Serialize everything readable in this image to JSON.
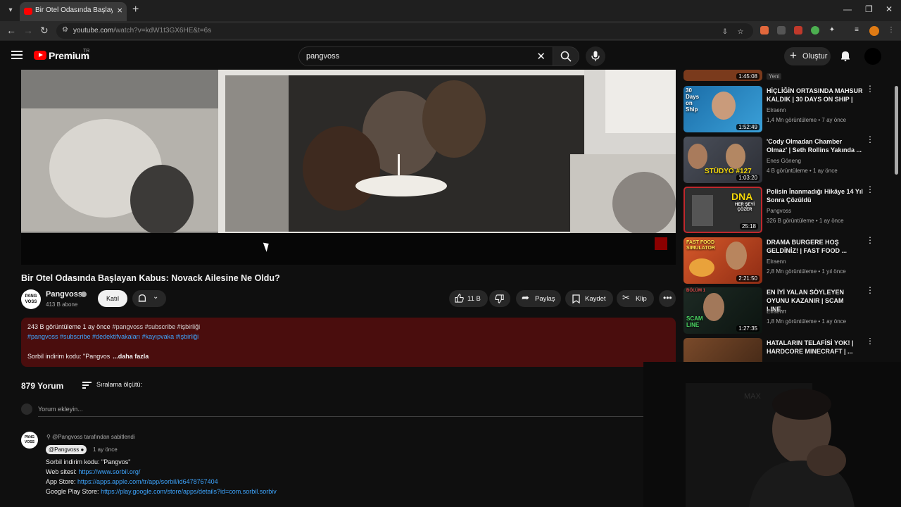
{
  "browser": {
    "tab_title": "Bir Otel Odasında Başlayan Kabus",
    "url_host": "youtube.com",
    "url_path": "/watch?v=kdW1t3GX6HE&t=6s"
  },
  "header": {
    "brand": "Premium",
    "brand_sup": "TR",
    "search_query": "pangvoss",
    "create_label": "Oluştur"
  },
  "video": {
    "title": "Bir Otel Odasında Başlayan Kabus: Novack Ailesine Ne Oldu?",
    "channel": "Pangvoss",
    "subscribers": "413 B abone",
    "join_label": "Katıl",
    "likes": "11 B",
    "share_label": "Paylaş",
    "save_label": "Kaydet",
    "clip_label": "Klip",
    "avatar_text": "PANG VOSS"
  },
  "description": {
    "views_time": "243 B görüntüleme  1 ay önce",
    "tags_line1": "#pangvoss #subscribe #işbirliği",
    "tags_line2": "#pangvoss #subscribe #dedektifvakaları #kayıpvaka #işbirliği",
    "promo": "Sorbil indirim kodu: \"Pangvos",
    "more": "...daha fazla"
  },
  "comments": {
    "count": "879 Yorum",
    "sort_label": "Sıralama ölçütü:",
    "add_placeholder": "Yorum ekleyin...",
    "pinned_by": "@Pangvoss tarafından sabitlendi",
    "author": "@Pangvoss",
    "time": "1 ay önce",
    "line1": "Sorbil indirim kodu: \"Pangvos\"",
    "line2_label": "Web sitesi:",
    "line2_link": "https://www.sorbil.org/",
    "line3_label": "App Store:",
    "line3_link": "https://apps.apple.com/tr/app/sorbil/id6478767404",
    "line4_label": "Google Play Store:",
    "line4_link": "https://play.google.com/store/apps/details?id=com.sorbil.sorbiv"
  },
  "related": [
    {
      "title": "",
      "channel": "Yeni",
      "stats": "",
      "duration": "1:45:08"
    },
    {
      "title": "HİÇLİĞİN ORTASINDA MAHSUR KALDIK | 30 DAYS ON SHIP |",
      "channel": "Elraenn",
      "stats": "1,4 Mn görüntüleme • 7 ay önce",
      "duration": "1:52:49",
      "thumb_text": "30 Days on Ship"
    },
    {
      "title": "'Cody Olmadan Chamber Olmaz' | Seth Rollins Yakında ...",
      "channel": "Enes Göneng",
      "stats": "4 B görüntüleme • 1 ay önce",
      "duration": "1:03:20",
      "thumb_text": "STÜDYO #127"
    },
    {
      "title": "Polisin İnanmadığı Hikâye 14 Yıl Sonra Çözüldü",
      "channel": "Pangvoss",
      "stats": "326 B görüntüleme • 1 ay önce",
      "duration": "25:18",
      "thumb_text": "DNA",
      "thumb_text2": "HER ŞEYİ ÇÖZER"
    },
    {
      "title": "DRAMA BURGERE HOŞ GELDİNİZ! | FAST FOOD ...",
      "channel": "Elraenn",
      "stats": "2,8 Mn görüntüleme • 1 yıl önce",
      "duration": "2:21:50",
      "thumb_text": "FAST FOOD SIMULATOR"
    },
    {
      "title": "EN İYİ YALAN SÖYLEYEN OYUNU KAZANIR | SCAM LINE...",
      "channel": "Elraenn",
      "stats": "1,8 Mn görüntüleme • 1 ay önce",
      "duration": "1:27:35",
      "thumb_text": "SCAM LINE",
      "thumb_text2": "BÖLÜM 1"
    },
    {
      "title": "HATALARIN TELAFİSİ YOK! | HARDCORE MINECRAFT | ...",
      "channel": "",
      "stats": "",
      "duration": ""
    }
  ],
  "webcam_watermark": "MAX",
  "colors": {
    "accent_red": "#ff0000",
    "desc_bg": "#4a0d0d",
    "link": "#3ea6ff"
  }
}
